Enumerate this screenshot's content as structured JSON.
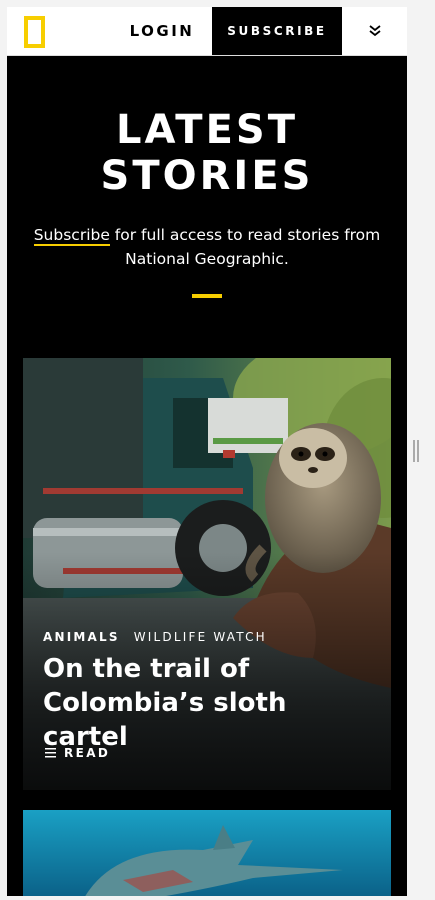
{
  "header": {
    "logo_alt": "National Geographic",
    "login_label": "LOGIN",
    "subscribe_label": "SUBSCRIBE",
    "menu_icon": "double-chevron-down-icon"
  },
  "hero": {
    "title_line1": "LATEST",
    "title_line2": "STORIES",
    "subtitle_link": "Subscribe",
    "subtitle_rest": " for full access to read stories from National Geographic."
  },
  "stories": [
    {
      "category": "ANIMALS",
      "series": "WILDLIFE WATCH",
      "title": "On the trail of Colombia’s sloth cartel",
      "read_label": "READ"
    }
  ],
  "colors": {
    "accent": "#f7ce00",
    "background": "#000000",
    "header": "#ffffff"
  }
}
